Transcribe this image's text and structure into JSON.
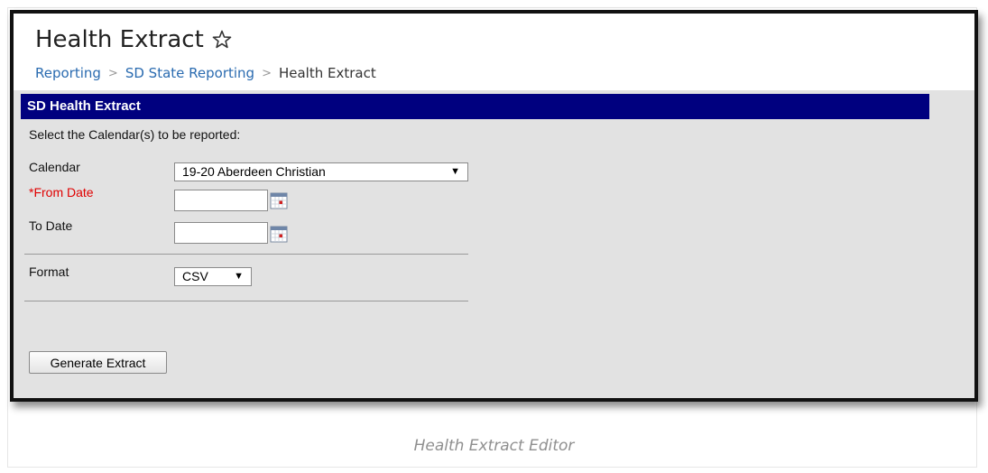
{
  "header": {
    "title": "Health Extract",
    "breadcrumb": [
      "Reporting",
      "SD State Reporting",
      "Health Extract"
    ],
    "breadcrumb_separator": ">"
  },
  "section": {
    "title": "SD Health Extract",
    "instruction": "Select the Calendar(s) to be reported:"
  },
  "form": {
    "calendar_label": "Calendar",
    "calendar_value": "19-20 Aberdeen Christian",
    "from_date_label": "*From Date",
    "from_date_value": "",
    "to_date_label": "To Date",
    "to_date_value": "",
    "format_label": "Format",
    "format_value": "CSV",
    "arrow": "▼"
  },
  "actions": {
    "generate_label": "Generate Extract"
  },
  "caption": "Health Extract Editor",
  "colors": {
    "section_header_bg": "#00007f",
    "link": "#2a6bb0",
    "required": "#e00000",
    "content_bg": "#e2e2e2"
  }
}
